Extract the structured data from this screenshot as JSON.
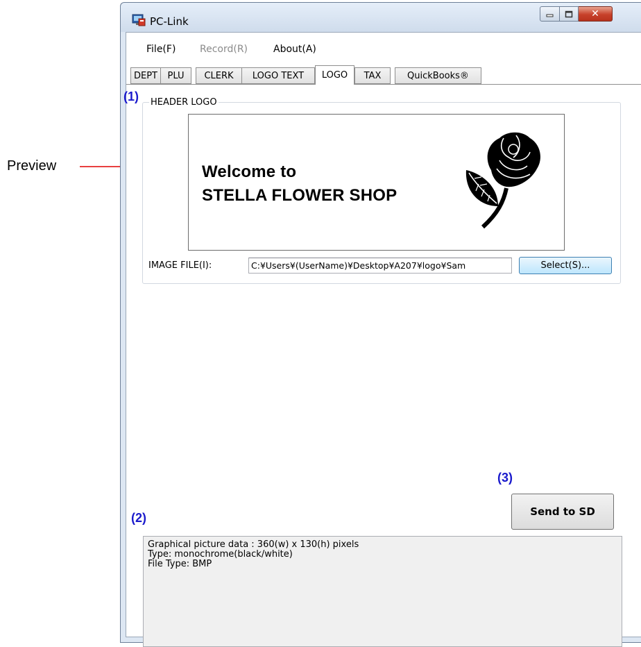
{
  "annotations": {
    "preview_label": "Preview",
    "callout_1": "(1)",
    "callout_2": "(2)",
    "callout_3": "(3)",
    "callout_color": "#1a1acc",
    "arrow_color": "#e00000"
  },
  "window": {
    "title": "PC-Link",
    "app_icon": "pc-link-app-icon",
    "minimize_icon": "minimize-icon",
    "maximize_icon": "maximize-icon",
    "close_icon": "close-icon"
  },
  "menu": {
    "items": [
      {
        "label": "File(F)",
        "enabled": true
      },
      {
        "label": "Record(R)",
        "enabled": false
      },
      {
        "label": "About(A)",
        "enabled": true
      }
    ]
  },
  "tabs": {
    "items": [
      {
        "label": "DEPT"
      },
      {
        "label": "PLU"
      },
      {
        "label": "CLERK"
      },
      {
        "label": "LOGO TEXT"
      },
      {
        "label": "LOGO"
      },
      {
        "label": "TAX"
      },
      {
        "label": "QuickBooks®"
      }
    ],
    "active": "LOGO"
  },
  "header_logo": {
    "group_title": "HEADER LOGO",
    "preview": {
      "line1": "Welcome to",
      "line2": "STELLA FLOWER SHOP",
      "image": "rose-icon"
    },
    "image_file_label": "IMAGE FILE(I):",
    "image_file_value": "C:¥Users¥(UserName)¥Desktop¥A207¥logo¥Sam",
    "select_button": "Select(S)..."
  },
  "send_button": "Send to SD",
  "info": {
    "lines": [
      "Graphical picture data : 360(w) x 130(h) pixels",
      "Type: monochrome(black/white)",
      "File Type: BMP"
    ]
  }
}
